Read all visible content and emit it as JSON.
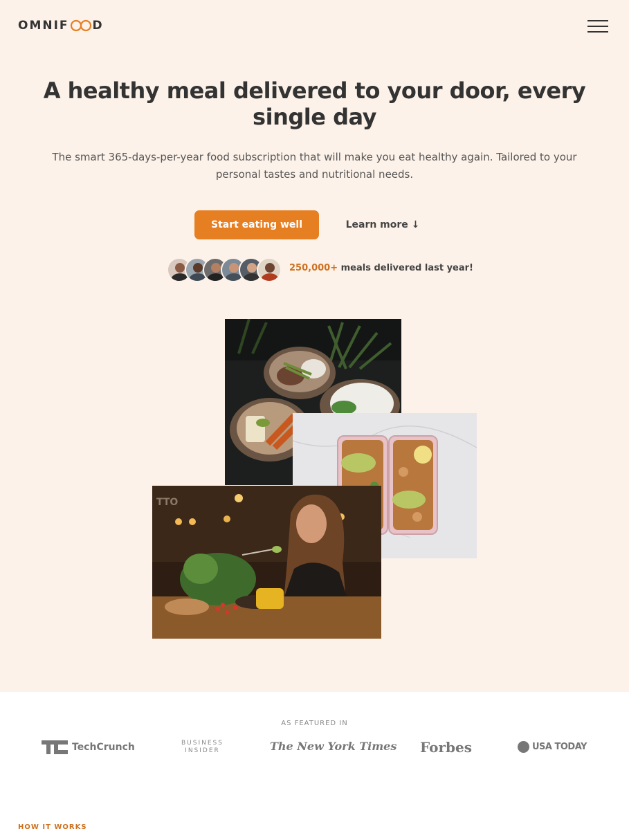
{
  "header": {
    "logo_left": "OMNIF",
    "logo_right": "D",
    "logo_accent_color": "#e67e22"
  },
  "hero": {
    "title": "A healthy meal delivered to your door, every single day",
    "description": "The smart 365-days-per-year food subscription that will make you eat healthy again. Tailored to your personal tastes and nutritional needs.",
    "cta_primary": "Start eating well",
    "cta_secondary": "Learn more ↓",
    "delivered_count": "250,000+",
    "delivered_text": " meals delivered last year!"
  },
  "featured": {
    "heading": "AS FEATURED IN",
    "logos": [
      "TechCrunch",
      "BUSINESS",
      "INSIDER",
      "The New York Times",
      "Forbes",
      "USA TODAY"
    ]
  },
  "next_section": {
    "label": "HOW IT WORKS"
  },
  "colors": {
    "background": "#fdf2e9",
    "primary": "#e67e22",
    "primary_dark": "#cf711f",
    "text": "#333333"
  }
}
